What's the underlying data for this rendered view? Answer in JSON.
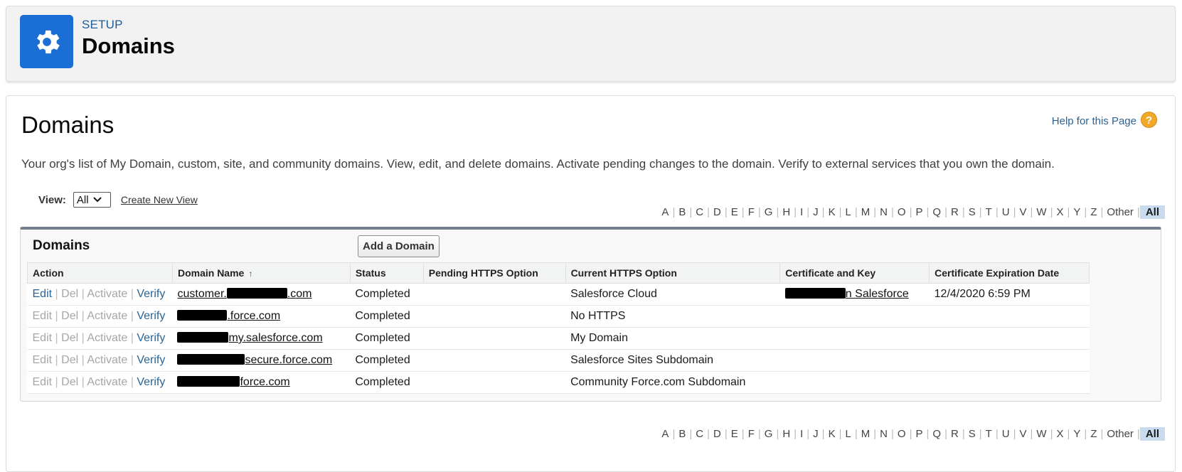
{
  "header": {
    "eyebrow": "SETUP",
    "title": "Domains",
    "icon": "gear-icon",
    "icon_color": "#1b6fd4"
  },
  "page": {
    "title": "Domains",
    "help_label": "Help for this Page",
    "description": "Your org's list of My Domain, custom, site, and community domains. View, edit, and delete domains. Activate pending changes to the domain. Verify to external services that you own the domain."
  },
  "view": {
    "label": "View:",
    "selected": "All",
    "create_label": "Create New View"
  },
  "alphabet": [
    "A",
    "B",
    "C",
    "D",
    "E",
    "F",
    "G",
    "H",
    "I",
    "J",
    "K",
    "L",
    "M",
    "N",
    "O",
    "P",
    "Q",
    "R",
    "S",
    "T",
    "U",
    "V",
    "W",
    "X",
    "Y",
    "Z",
    "Other",
    "All"
  ],
  "alphabet_selected": "All",
  "list": {
    "title": "Domains",
    "add_button": "Add a Domain",
    "columns": [
      "Action",
      "Domain Name",
      "Status",
      "Pending HTTPS Option",
      "Current HTTPS Option",
      "Certificate and Key",
      "Certificate Expiration Date"
    ],
    "actions": {
      "edit": "Edit",
      "del": "Del",
      "activate": "Activate",
      "verify": "Verify",
      "sep": "|"
    },
    "rows": [
      {
        "domain_visible": "customer.",
        "domain_suffix": ".com",
        "status": "Completed",
        "pending": "",
        "current": "Salesforce Cloud",
        "cert_suffix": "n Salesforce",
        "expiration": "12/4/2020 6:59 PM",
        "edit_enabled": true
      },
      {
        "domain_visible": "",
        "domain_suffix": ".force.com",
        "status": "Completed",
        "pending": "",
        "current": "No HTTPS",
        "cert_suffix": "",
        "expiration": "",
        "edit_enabled": false
      },
      {
        "domain_visible": "",
        "domain_suffix": "my.salesforce.com",
        "status": "Completed",
        "pending": "",
        "current": "My Domain",
        "cert_suffix": "",
        "expiration": "",
        "edit_enabled": false
      },
      {
        "domain_visible": "",
        "domain_suffix": "secure.force.com",
        "status": "Completed",
        "pending": "",
        "current": "Salesforce Sites Subdomain",
        "cert_suffix": "",
        "expiration": "",
        "edit_enabled": false
      },
      {
        "domain_visible": "",
        "domain_suffix": "force.com",
        "status": "Completed",
        "pending": "",
        "current": "Community Force.com Subdomain",
        "cert_suffix": "",
        "expiration": "",
        "edit_enabled": false
      }
    ]
  }
}
